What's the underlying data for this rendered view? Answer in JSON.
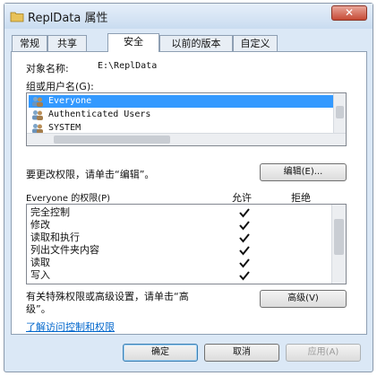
{
  "window": {
    "title": "ReplData 属性",
    "close_glyph": "✕"
  },
  "tabs": [
    {
      "label": "常规",
      "active": false
    },
    {
      "label": "共享",
      "active": false
    },
    {
      "label": "安全",
      "active": true
    },
    {
      "label": "以前的版本",
      "active": false
    },
    {
      "label": "自定义",
      "active": false
    }
  ],
  "object": {
    "label": "对象名称:",
    "value": "E:\\ReplData"
  },
  "groups": {
    "label": "组或用户名(G):",
    "items": [
      {
        "name": "Everyone",
        "selected": true
      },
      {
        "name": "Authenticated Users",
        "selected": false
      },
      {
        "name": "SYSTEM",
        "selected": false
      }
    ]
  },
  "change_hint": "要更改权限，请单击“编辑”。",
  "edit_button": "编辑(E)...",
  "permissions": {
    "header": "Everyone 的权限(P)",
    "allow_col": "允许",
    "deny_col": "拒绝",
    "rows": [
      {
        "name": "完全控制",
        "allow": true,
        "deny": false
      },
      {
        "name": "修改",
        "allow": true,
        "deny": false
      },
      {
        "name": "读取和执行",
        "allow": true,
        "deny": false
      },
      {
        "name": "列出文件夹内容",
        "allow": true,
        "deny": false
      },
      {
        "name": "读取",
        "allow": true,
        "deny": false
      },
      {
        "name": "写入",
        "allow": true,
        "deny": false
      }
    ]
  },
  "advanced": {
    "hint_line1": "有关特殊权限或高级设置，请单击“高",
    "hint_line2": "级”。",
    "button": "高级(V)"
  },
  "learn_link": "了解访问控制和权限",
  "footer": {
    "ok": "确定",
    "cancel": "取消",
    "apply": "应用(A)"
  },
  "colors": {
    "selection": "#3399ff",
    "link": "#0066cc"
  }
}
